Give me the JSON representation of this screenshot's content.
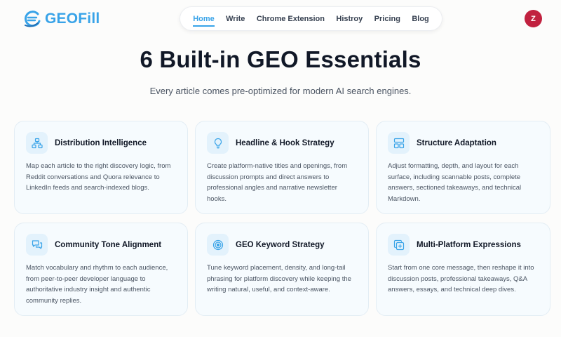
{
  "brand": {
    "name": "GEOFill",
    "accent": "#38a3e8"
  },
  "nav": {
    "items": [
      {
        "label": "Home",
        "active": true
      },
      {
        "label": "Write"
      },
      {
        "label": "Chrome Extension"
      },
      {
        "label": "Histroy"
      },
      {
        "label": "Pricing"
      },
      {
        "label": "Blog"
      }
    ]
  },
  "user": {
    "initial": "Z",
    "avatar_color": "#c1213f"
  },
  "hero": {
    "title": "6 Built-in GEO Essentials",
    "subtitle": "Every article comes pre-optimized for modern AI search engines."
  },
  "cards": [
    {
      "icon": "sitemap-icon",
      "title": "Distribution Intelligence",
      "desc": "Map each article to the right discovery logic, from Reddit conversations and Quora relevance to LinkedIn feeds and search-indexed blogs."
    },
    {
      "icon": "lightbulb-icon",
      "title": "Headline & Hook Strategy",
      "desc": "Create platform-native titles and openings, from discussion prompts and direct answers to professional angles and narrative newsletter hooks."
    },
    {
      "icon": "layout-icon",
      "title": "Structure Adaptation",
      "desc": "Adjust formatting, depth, and layout for each surface, including scannable posts, complete answers, sectioned takeaways, and technical Markdown."
    },
    {
      "icon": "chat-icon",
      "title": "Community Tone Alignment",
      "desc": "Match vocabulary and rhythm to each audience, from peer-to-peer developer language to authoritative industry insight and authentic community replies."
    },
    {
      "icon": "target-icon",
      "title": "GEO Keyword Strategy",
      "desc": "Tune keyword placement, density, and long-tail phrasing for platform discovery while keeping the writing natural, useful, and context-aware."
    },
    {
      "icon": "copy-plus-icon",
      "title": "Multi-Platform Expressions",
      "desc": "Start from one core message, then reshape it into discussion posts, professional takeaways, Q&A answers, essays, and technical deep dives."
    }
  ]
}
